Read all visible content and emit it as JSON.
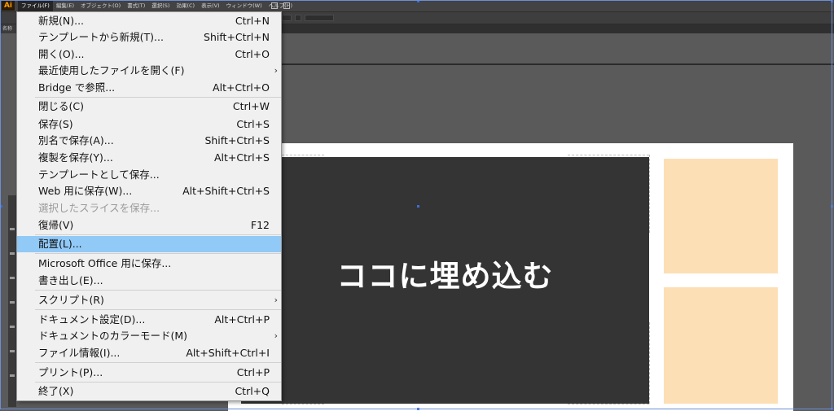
{
  "app": {
    "logo": "Ai",
    "menus": [
      "ファイル(F)",
      "編集(E)",
      "オブジェクト(O)",
      "書式(T)",
      "選択(S)",
      "効果(C)",
      "表示(V)",
      "ウィンドウ(W)",
      "ヘルプ(H)"
    ],
    "active_menu": 0,
    "tab_label": "名称"
  },
  "file_menu": {
    "items": [
      {
        "label": "新規(N)...",
        "shortcut": "Ctrl+N"
      },
      {
        "label": "テンプレートから新規(T)...",
        "shortcut": "Shift+Ctrl+N"
      },
      {
        "label": "開く(O)...",
        "shortcut": "Ctrl+O"
      },
      {
        "label": "最近使用したファイルを開く(F)",
        "shortcut": "",
        "submenu": "›"
      },
      {
        "label": "Bridge で参照...",
        "shortcut": "Alt+Ctrl+O"
      },
      {
        "label": "閉じる(C)",
        "shortcut": "Ctrl+W"
      },
      {
        "label": "保存(S)",
        "shortcut": "Ctrl+S"
      },
      {
        "label": "別名で保存(A)...",
        "shortcut": "Shift+Ctrl+S"
      },
      {
        "label": "複製を保存(Y)...",
        "shortcut": "Alt+Ctrl+S"
      },
      {
        "label": "テンプレートとして保存...",
        "shortcut": ""
      },
      {
        "label": "Web 用に保存(W)...",
        "shortcut": "Alt+Shift+Ctrl+S"
      },
      {
        "label": "選択したスライスを保存...",
        "shortcut": ""
      },
      {
        "label": "復帰(V)",
        "shortcut": "F12"
      },
      {
        "label": "配置(L)...",
        "shortcut": ""
      },
      {
        "label": "Microsoft Office 用に保存...",
        "shortcut": ""
      },
      {
        "label": "書き出し(E)...",
        "shortcut": ""
      },
      {
        "label": "スクリプト(R)",
        "shortcut": "",
        "submenu": "›"
      },
      {
        "label": "ドキュメント設定(D)...",
        "shortcut": "Alt+Ctrl+P"
      },
      {
        "label": "ドキュメントのカラーモード(M)",
        "shortcut": "",
        "submenu": "›"
      },
      {
        "label": "ファイル情報(I)...",
        "shortcut": "Alt+Shift+Ctrl+I"
      },
      {
        "label": "プリント(P)...",
        "shortcut": "Ctrl+P"
      },
      {
        "label": "終了(X)",
        "shortcut": "Ctrl+Q"
      }
    ],
    "highlighted_index": 13,
    "disabled_index": 11
  },
  "canvas": {
    "embed_text": "ココに埋め込む",
    "colors": {
      "dark_box": "#343434",
      "peach": "#fddfb5",
      "highlight": "#91c9f7"
    }
  }
}
